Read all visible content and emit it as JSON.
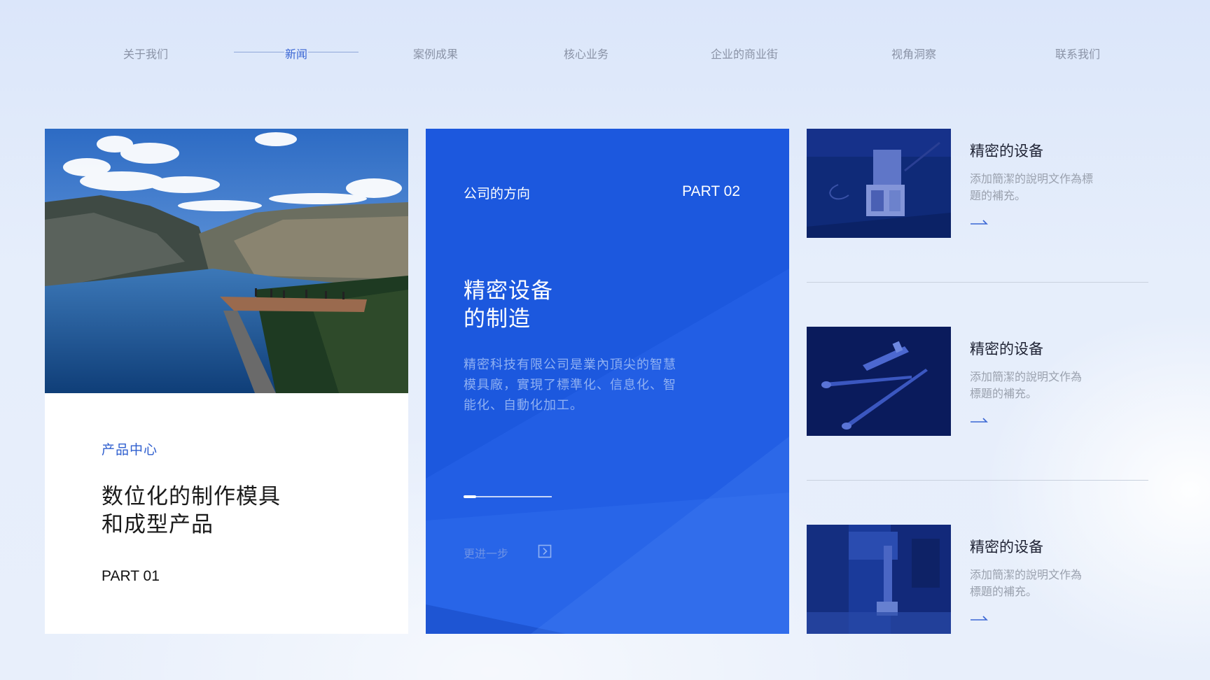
{
  "nav": {
    "items": [
      {
        "label": "关于我们",
        "active": false
      },
      {
        "label": "新闻",
        "active": true
      },
      {
        "label": "案例成果",
        "active": false
      },
      {
        "label": "核心业务",
        "active": false
      },
      {
        "label": "企业的商业街",
        "active": false
      },
      {
        "label": "视角洞察",
        "active": false
      },
      {
        "label": "联系我们",
        "active": false
      }
    ]
  },
  "card1": {
    "kicker": "产品中心",
    "title_line1": "数位化的制作模具",
    "title_line2": "和成型产品",
    "part": "PART 01"
  },
  "card2": {
    "heading": "公司的方向",
    "part": "PART 02",
    "title_line1": "精密设备",
    "title_line2": "的制造",
    "description": "精密科技有限公司是業內頂尖的智慧模具廠，實現了標準化、信息化、智能化、自動化加工。",
    "more_label": "更进一步",
    "color": "#1c58de"
  },
  "list": [
    {
      "title": "精密的设备",
      "desc_line1": "添加簡潔的說明文作為標",
      "desc_line2": "題的補充。"
    },
    {
      "title": "精密的设备",
      "desc_line1": "添加簡潔的說明文作為",
      "desc_line2": "標題的補充。"
    },
    {
      "title": "精密的设备",
      "desc_line1": "添加簡潔的說明文作為",
      "desc_line2": "標題的補充。"
    }
  ],
  "colors": {
    "accent": "#2f5fcf",
    "nav_text": "#8a93a6",
    "nav_active": "#3a66d4"
  }
}
